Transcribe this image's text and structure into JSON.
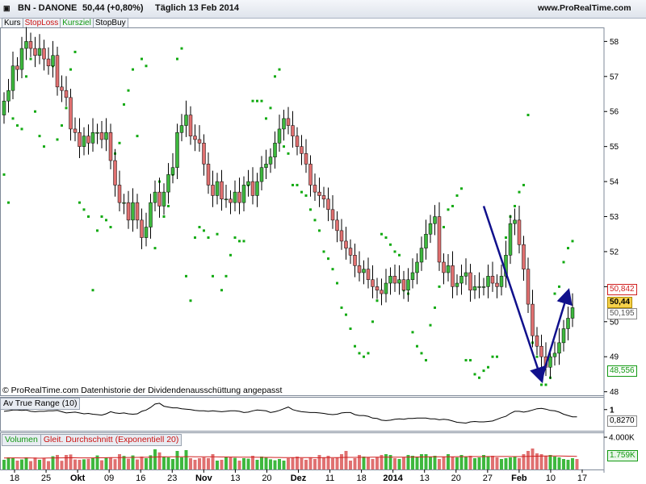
{
  "header": {
    "symbol_title": "BN - DANONE",
    "price_change": "50,44 (+0,80%)",
    "period_date": "Täglich  13 Feb 2014",
    "site": "www.ProRealTime.com"
  },
  "tabs": [
    {
      "label": "Kurs",
      "color": "#000000"
    },
    {
      "label": "StopLoss",
      "color": "#cc1111"
    },
    {
      "label": "Kursziel",
      "color": "#119911"
    },
    {
      "label": "StopBuy",
      "color": "#000000"
    }
  ],
  "footnote": "© ProRealTime.com Datenhistorie der Dividendenausschüttung angepasst",
  "colors": {
    "up_candle": "#3db83d",
    "down_candle": "#e07070",
    "wick": "#000000",
    "sar_dots": "#11aa11",
    "trend_arrow": "#10108c",
    "atr_line": "#000000",
    "ema_line": "#d02020"
  },
  "badges": {
    "r1": {
      "text": "50,842",
      "color": "#d02020"
    },
    "price": {
      "text": "50,44",
      "bg": "#f7d24a"
    },
    "r2": {
      "text": "50,195",
      "color": "#555555"
    },
    "target": {
      "text": "48,556",
      "color": "#119911"
    },
    "atr_value": {
      "text": "0,8270"
    },
    "vol_value": {
      "text": "1.759K",
      "color": "#119911"
    }
  },
  "chart_data": [
    {
      "type": "candlestick",
      "title": "",
      "ylim": [
        47.9,
        58.4
      ],
      "y_ticks": [
        48,
        49,
        50,
        51,
        52,
        53,
        54,
        55,
        56,
        57,
        58
      ],
      "x_ticks": [
        "18",
        "25",
        "Okt",
        "09",
        "16",
        "23",
        "Nov",
        "13",
        "20",
        "Dez",
        "11",
        "18",
        "2014",
        "13",
        "20",
        "27",
        "Feb",
        "10",
        "17"
      ],
      "start_price": 55.9,
      "closes": [
        56.3,
        56.6,
        57.3,
        57.2,
        57.8,
        58.0,
        57.8,
        57.6,
        57.8,
        57.5,
        57.3,
        57.6,
        56.7,
        56.6,
        56.4,
        55.5,
        55.4,
        55.0,
        55.3,
        55.1,
        55.4,
        55.4,
        55.2,
        55.4,
        54.6,
        53.9,
        53.4,
        53.4,
        52.9,
        53.4,
        52.9,
        52.4,
        52.7,
        53.4,
        53.7,
        53.3,
        53.7,
        54.2,
        54.4,
        55.4,
        55.6,
        55.9,
        55.3,
        55.2,
        55.1,
        54.5,
        53.9,
        53.6,
        54.0,
        53.5,
        53.5,
        53.4,
        53.7,
        53.4,
        53.9,
        54.0,
        53.6,
        54.0,
        54.4,
        54.5,
        54.7,
        55.1,
        55.5,
        55.8,
        55.6,
        55.3,
        55.0,
        54.8,
        54.5,
        53.9,
        53.7,
        53.6,
        53.5,
        53.2,
        52.9,
        52.6,
        52.3,
        52.1,
        51.9,
        51.6,
        51.4,
        51.5,
        51.2,
        51.0,
        50.9,
        50.8,
        51.1,
        51.3,
        51.1,
        51.2,
        50.9,
        51.2,
        51.4,
        51.7,
        52.1,
        52.5,
        52.8,
        53.0,
        51.7,
        51.4,
        51.6,
        51.0,
        51.1,
        51.3,
        51.4,
        50.9,
        51.0,
        51.0,
        51.0,
        51.3,
        51.1,
        51.0,
        51.3,
        51.9,
        52.8,
        52.9,
        52.2,
        51.5,
        50.5,
        49.6,
        49.3,
        49.0,
        48.7,
        49.0,
        49.1,
        49.4,
        49.8,
        50.1,
        50.4
      ],
      "opens": [
        55.9,
        56.3,
        56.6,
        57.3,
        57.2,
        57.8,
        58.0,
        57.8,
        57.6,
        57.8,
        57.5,
        57.3,
        57.6,
        56.7,
        56.6,
        56.4,
        55.5,
        55.4,
        55.0,
        55.3,
        55.1,
        55.4,
        55.4,
        55.2,
        55.4,
        54.6,
        53.9,
        53.4,
        53.4,
        52.9,
        53.4,
        52.9,
        52.4,
        52.7,
        53.4,
        53.7,
        53.3,
        53.7,
        54.2,
        54.4,
        55.4,
        55.6,
        55.9,
        55.3,
        55.2,
        55.1,
        54.5,
        53.9,
        53.6,
        54.0,
        53.5,
        53.5,
        53.4,
        53.7,
        53.4,
        53.9,
        54.0,
        53.6,
        54.0,
        54.4,
        54.5,
        54.7,
        55.1,
        55.5,
        55.8,
        55.6,
        55.3,
        55.0,
        54.8,
        54.5,
        53.9,
        53.7,
        53.6,
        53.5,
        53.2,
        52.9,
        52.6,
        52.3,
        52.1,
        51.9,
        51.6,
        51.4,
        51.5,
        51.2,
        51.0,
        50.9,
        50.8,
        51.1,
        51.3,
        51.1,
        51.2,
        50.9,
        51.2,
        51.4,
        51.7,
        52.1,
        52.5,
        52.8,
        53.0,
        51.7,
        51.4,
        51.6,
        51.0,
        51.1,
        51.3,
        51.4,
        50.9,
        51.0,
        51.0,
        51.0,
        51.3,
        51.1,
        51.0,
        51.3,
        51.9,
        52.8,
        52.9,
        52.2,
        51.5,
        50.5,
        49.6,
        49.3,
        49.0,
        48.7,
        49.0,
        49.1,
        49.4,
        49.8,
        50.1
      ],
      "sar": [
        54.2,
        53.4,
        55.8,
        55.6,
        55.5,
        57.0,
        57.5,
        56.0,
        55.3,
        55.0,
        57.4,
        57.3,
        55.2,
        55.6,
        56.1,
        57.2,
        57.7,
        53.4,
        53.2,
        53.0,
        50.9,
        52.6,
        53.0,
        52.9,
        52.7,
        54.8,
        55.1,
        56.2,
        56.6,
        57.2,
        55.3,
        57.5,
        57.3,
        53.2,
        52.1,
        54.0,
        53.0,
        53.3,
        54.2,
        57.5,
        57.8,
        51.3,
        50.6,
        52.4,
        52.7,
        52.6,
        52.4,
        51.3,
        52.5,
        50.9,
        51.3,
        51.9,
        52.4,
        52.3,
        52.3,
        53.9,
        56.3,
        56.3,
        56.3,
        55.8,
        56.1,
        57.0,
        57.2,
        55.0,
        54.8,
        53.9,
        53.9,
        53.7,
        53.6,
        53.2,
        52.9,
        52.6,
        52.0,
        51.8,
        51.5,
        51.1,
        50.4,
        50.2,
        49.8,
        49.3,
        49.1,
        49.0,
        49.1,
        50.0,
        50.6,
        52.5,
        52.4,
        52.2,
        52.0,
        51.9,
        50.9,
        50.8,
        49.7,
        49.3,
        49.1,
        48.9,
        49.9,
        50.4,
        51.0,
        52.7,
        53.2,
        53.3,
        53.6,
        53.8,
        48.9,
        48.9,
        48.5,
        48.4,
        48.6,
        48.7,
        49.0,
        49.0,
        51.2,
        52.4,
        53.0,
        53.3,
        53.7,
        53.9,
        55.9,
        49.4,
        49.0,
        48.2,
        48.2,
        48.4,
        50.8,
        51.0,
        51.7,
        52.1,
        52.3
      ]
    },
    {
      "type": "line",
      "title": "Av True Range (10)",
      "ylim": [
        0.5,
        1.3
      ],
      "y_ticks": [
        1
      ],
      "values": [
        0.96,
        0.97,
        0.99,
        0.99,
        0.98,
        0.99,
        0.96,
        0.95,
        0.96,
        0.96,
        0.97,
        0.97,
        0.98,
        0.95,
        0.92,
        0.93,
        0.94,
        0.92,
        0.9,
        0.91,
        0.89,
        0.88,
        0.87,
        0.9,
        0.95,
        0.92,
        0.91,
        0.92,
        0.9,
        0.89,
        0.9,
        0.96,
        0.99,
        1.05,
        1.13,
        1.15,
        1.08,
        1.06,
        1.04,
        1.04,
        1.02,
        1.01,
        1.0,
        0.98,
        0.97,
        0.97,
        0.96,
        0.97,
        0.96,
        0.95,
        0.96,
        0.97,
        0.97,
        0.96,
        0.93,
        0.94,
        0.97,
        0.99,
        0.98,
        0.97,
        0.93,
        0.95,
        0.98,
        1.02,
        1.06,
        1.0,
        0.97,
        0.95,
        0.94,
        0.93,
        0.93,
        0.92,
        0.91,
        0.89,
        0.88,
        0.89,
        0.92,
        0.93,
        0.93,
        0.88,
        0.86,
        0.86,
        0.84,
        0.8,
        0.79,
        0.75,
        0.74,
        0.75,
        0.77,
        0.78,
        0.77,
        0.79,
        0.79,
        0.8,
        0.8,
        0.8,
        0.78,
        0.78,
        0.76,
        0.77,
        0.76,
        0.73,
        0.7,
        0.69,
        0.68,
        0.71,
        0.72,
        0.71,
        0.71,
        0.72,
        0.73,
        0.77,
        0.81,
        0.84,
        0.91,
        0.96,
        0.96,
        0.94,
        0.96,
        0.99,
        1.02,
        1.03,
        1.01,
        0.98,
        0.97,
        0.94,
        0.89,
        0.86,
        0.83,
        0.83
      ]
    },
    {
      "type": "bar",
      "title": "Gleit. Durchschnitt (Exponentiell 20)",
      "series_label": "Volumen",
      "ylim": [
        0,
        4600
      ],
      "y_ticks": [
        "4.000K"
      ],
      "values": [
        1200,
        1500,
        1440,
        1100,
        1240,
        1500,
        1040,
        1480,
        1200,
        1440,
        1040,
        1640,
        1800,
        1080,
        1800,
        1860,
        1240,
        1200,
        1260,
        1320,
        1400,
        1740,
        1140,
        1500,
        1480,
        1280,
        1900,
        1680,
        1340,
        1740,
        1240,
        1600,
        1400,
        1760,
        2500,
        2120,
        1600,
        1500,
        1300,
        2300,
        1500,
        2400,
        1400,
        1200,
        1400,
        1500,
        1400,
        1900,
        1100,
        1200,
        1600,
        1540,
        1440,
        1100,
        1400,
        1340,
        1700,
        1200,
        1600,
        1500,
        1260,
        1140,
        1300,
        1100,
        1400,
        1500,
        1600,
        1400,
        1200,
        1460,
        1300,
        1800,
        1500,
        1700,
        1400,
        1500,
        1900,
        2300,
        1100,
        1400,
        1800,
        1600,
        1540,
        1300,
        1500,
        1800,
        1900,
        1800,
        1400,
        1300,
        1500,
        1800,
        1700,
        1600,
        1900,
        1900,
        1600,
        1700,
        1300,
        1600,
        1900,
        1600,
        1500,
        1800,
        1600,
        1700,
        1400,
        1500,
        1800,
        1600,
        1700,
        1500,
        1300,
        1400,
        1500,
        1600,
        1400,
        1900,
        2300,
        2600,
        2000,
        1900,
        1700,
        1800,
        1600,
        1500,
        1300,
        1200,
        1400,
        1300
      ],
      "ema": [
        1420,
        1430,
        1440,
        1440,
        1430,
        1440,
        1420,
        1410,
        1400,
        1410,
        1420,
        1430,
        1440,
        1440,
        1450,
        1460,
        1450,
        1440,
        1440,
        1440,
        1440,
        1450,
        1450,
        1460,
        1470,
        1470,
        1480,
        1490,
        1490,
        1500,
        1500,
        1510,
        1510,
        1520,
        1540,
        1560,
        1570,
        1570,
        1570,
        1580,
        1580,
        1590,
        1590,
        1580,
        1580,
        1570,
        1570,
        1570,
        1560,
        1550,
        1550,
        1540,
        1540,
        1530,
        1520,
        1520,
        1520,
        1510,
        1510,
        1500,
        1500,
        1490,
        1490,
        1480,
        1480,
        1480,
        1480,
        1470,
        1470,
        1470,
        1460,
        1460,
        1470,
        1480,
        1480,
        1480,
        1490,
        1500,
        1500,
        1500,
        1510,
        1510,
        1510,
        1520,
        1520,
        1520,
        1530,
        1530,
        1530,
        1530,
        1530,
        1540,
        1540,
        1550,
        1550,
        1560,
        1570,
        1570,
        1580,
        1580,
        1580,
        1580,
        1590,
        1590,
        1590,
        1600,
        1600,
        1600,
        1600,
        1610,
        1610,
        1610,
        1610,
        1610,
        1610,
        1600,
        1600,
        1610,
        1620,
        1640,
        1650,
        1660,
        1670,
        1670,
        1670,
        1670,
        1660,
        1650,
        1640,
        1630
      ]
    }
  ]
}
